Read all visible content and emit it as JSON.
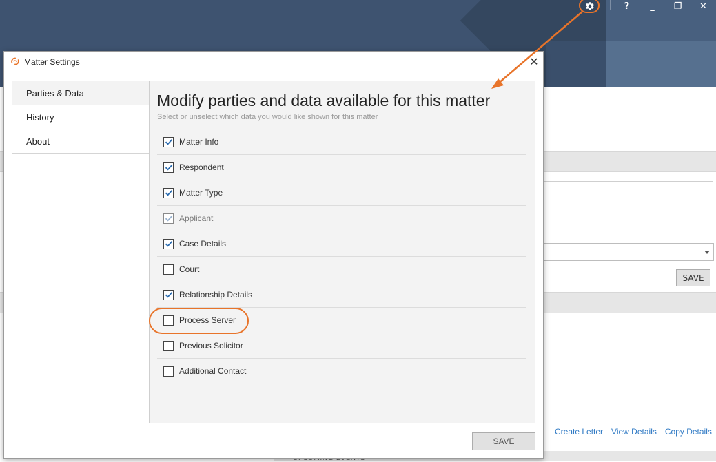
{
  "app": {
    "titlebar_icons": [
      "gear-icon",
      "help-icon",
      "minimize-icon",
      "restore-icon",
      "close-icon"
    ],
    "titlebar_glyphs": {
      "help": "?",
      "minimize": "_",
      "restore": "❐",
      "close": "✕"
    },
    "right_panel": {
      "save_label": "SAVE",
      "links": [
        "Create Letter",
        "View Details",
        "Copy Details"
      ],
      "bottom_section_label": "UPCOMING EVENTS"
    }
  },
  "dialog": {
    "title": "Matter Settings",
    "sidebar_items": [
      {
        "label": "Parties & Data",
        "active": true
      },
      {
        "label": "History",
        "active": false
      },
      {
        "label": "About",
        "active": false
      }
    ],
    "heading": "Modify parties and data available for this matter",
    "subheading": "Select or unselect which data you would like shown for this matter",
    "options": [
      {
        "label": "Matter Info",
        "checked": true,
        "disabled": false
      },
      {
        "label": "Respondent",
        "checked": true,
        "disabled": false
      },
      {
        "label": "Matter Type",
        "checked": true,
        "disabled": false
      },
      {
        "label": "Applicant",
        "checked": true,
        "disabled": true
      },
      {
        "label": "Case Details",
        "checked": true,
        "disabled": false
      },
      {
        "label": "Court",
        "checked": false,
        "disabled": false
      },
      {
        "label": "Relationship Details",
        "checked": true,
        "disabled": false
      },
      {
        "label": "Process Server",
        "checked": false,
        "disabled": false
      },
      {
        "label": "Previous Solicitor",
        "checked": false,
        "disabled": false
      },
      {
        "label": "Additional Contact",
        "checked": false,
        "disabled": false
      }
    ],
    "save_label": "SAVE"
  },
  "colors": {
    "titlebar": "#3e5370",
    "accent": "#e8742a",
    "check": "#2b6cb0",
    "link": "#2e79c4"
  }
}
